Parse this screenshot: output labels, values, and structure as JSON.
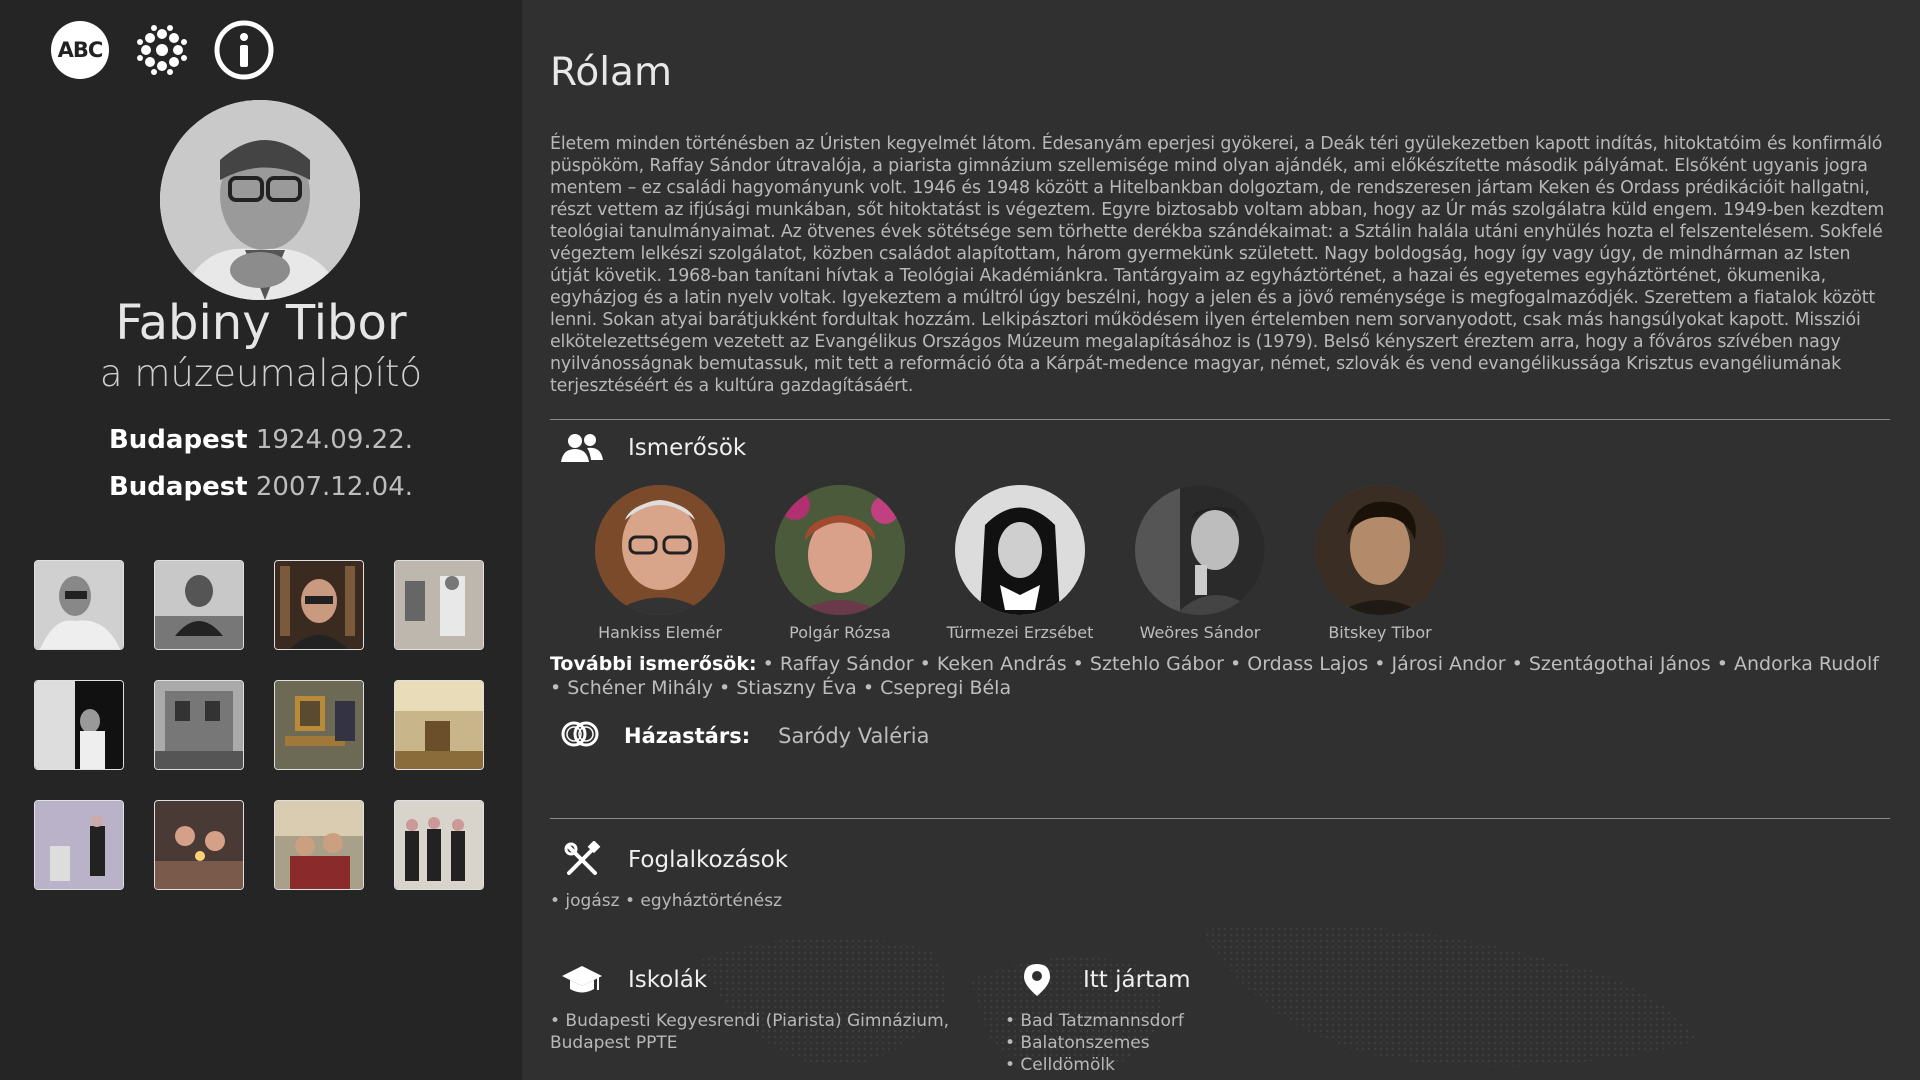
{
  "sidebar": {
    "icons": [
      "abc-icon",
      "network-icon",
      "info-icon"
    ],
    "abc_label": "ABC",
    "name": "Fabiny Tibor",
    "subtitle": "a múzeumalapító",
    "birth": {
      "place": "Budapest",
      "date": "1924.09.22."
    },
    "death": {
      "place": "Budapest",
      "date": "2007.12.04."
    }
  },
  "main": {
    "title": "Rólam",
    "bio": "Életem minden történésben az Úristen kegyelmét látom. Édesanyám eperjesi gyökerei, a Deák téri gyülekezetben kapott indítás, hitoktatóim és konfirmáló püspököm, Raffay Sándor útravalója, a piarista gimnázium szellemisége mind olyan ajándék, ami előkészítette második pályámat. Elsőként ugyanis jogra mentem – ez családi hagyományunk volt. 1946 és 1948 között a Hitelbankban dolgoztam, de rendszeresen jártam Keken és Ordass prédikációit hallgatni, részt vettem az ifjúsági munkában, sőt hitoktatást is végeztem. Egyre biztosabb voltam abban, hogy az Úr más szolgálatra küld engem. 1949-ben kezdtem teológiai tanulmányaimat. Az ötvenes évek sötétsége sem törhette derékba szándékaimat: a Sztálin halála utáni enyhülés hozta el felszentelésem. Sokfelé végeztem lelkészi szolgálatot, közben családot alapítottam, három gyermekünk született. Nagy boldogság, hogy így vagy úgy, de mindhárman az Isten útját követik. 1968-ban tanítani hívtak a Teológiai Akadémiánkra. Tantárgyaim az egyháztörténet, a hazai és egyetemes egyháztörténet, ökumenika, egyházjog és a latin nyelv voltak. Igyekeztem a múltról úgy beszélni, hogy a jelen és a jövő reménysége is megfogalmazódjék. Szerettem a fiatalok között lenni. Sokan atyai barátjukként fordultak hozzám. Lelkipásztori működésem ilyen értelemben nem sorvanyodott, csak más hangsúlyokat kapott. Missziói elkötelezettségem vezetett az Evangélikus Országos Múzeum megalapításához is (1979). Belső kényszert éreztem arra, hogy a főváros szívében nagy nyilvánosságnak bemutassuk, mit tett a reformáció óta a Kárpát-medence magyar, német, szlovák és vend evangélikussága Krisztus evangéliumának terjesztéséért és a kultúra gazdagításáért.",
    "acquaintances_title": "Ismerősök",
    "friends": [
      {
        "name": "Hankiss Elemér"
      },
      {
        "name": "Polgár Rózsa"
      },
      {
        "name": "Türmezei Erzsébet"
      },
      {
        "name": "Weöres Sándor"
      },
      {
        "name": "Bitskey Tibor"
      }
    ],
    "more_label": "További ismerősök:",
    "more_friends": [
      "Raffay Sándor",
      "Keken András",
      "Sztehlo Gábor",
      "Ordass Lajos",
      "Járosi Andor",
      "Szentágothai János",
      "Andorka Rudolf",
      "Schéner Mihály",
      "Stiaszny Éva",
      "Csepregi Béla"
    ],
    "spouse_label": "Házastárs:",
    "spouse": "Saródy Valéria",
    "occupations_title": "Foglalkozások",
    "occupations_text": "• jogász • egyháztörténész",
    "schools_title": "Iskolák",
    "schools": [
      "• Budapesti Kegyesrendi (Piarista) Gimnázium,",
      "Budapest PPTE"
    ],
    "places_title": "Itt jártam",
    "places": [
      "• Bad Tatzmannsdorf",
      "• Balatonszemes",
      "• Celldömölk"
    ]
  }
}
